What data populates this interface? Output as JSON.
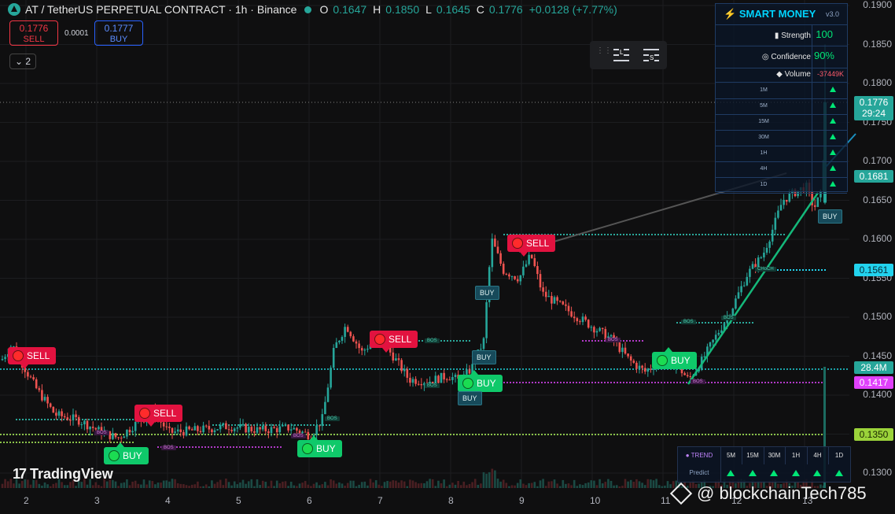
{
  "header": {
    "title": "AT / TetherUS PERPETUAL CONTRACT · 1h · Binance",
    "o_label": "O",
    "o_value": "0.1647",
    "h_label": "H",
    "h_value": "0.1850",
    "l_label": "L",
    "l_value": "0.1645",
    "c_label": "C",
    "c_value": "0.1776",
    "change": "+0.0128 (+7.77%)"
  },
  "trade": {
    "sell_price": "0.1776",
    "sell_label": "SELL",
    "spread": "0.0001",
    "buy_price": "0.1777",
    "buy_label": "BUY"
  },
  "indicators_toggle": "2",
  "toolbox": {
    "left_tag": "L",
    "right_tag": "S"
  },
  "price_axis": [
    "0.1900",
    "0.1850",
    "0.1800",
    "0.1750",
    "0.1700",
    "0.1650",
    "0.1600",
    "0.1550",
    "0.1500",
    "0.1450",
    "0.1400",
    "0.1350",
    "0.1300"
  ],
  "price_tags": {
    "last_price": "0.1776",
    "countdown": "29:24",
    "level_1681": "0.1681",
    "level_1561": "0.1561",
    "volume": "28.4M",
    "level_1417": "0.1417",
    "level_1350": "0.1350"
  },
  "time_axis": [
    "2",
    "3",
    "4",
    "5",
    "6",
    "7",
    "8",
    "9",
    "10",
    "11",
    "12",
    "13"
  ],
  "smart_money": {
    "title": "SMART MONEY",
    "version": "v3.0",
    "strength_label": "Strength",
    "strength": "100",
    "confidence_label": "Confidence",
    "confidence": "90%",
    "volume_label": "Volume",
    "volume": "-37449K",
    "timeframes": [
      "1M",
      "5M",
      "15M",
      "30M",
      "1H",
      "4H",
      "1D"
    ]
  },
  "trend_table": {
    "title": "TREND",
    "cols": [
      "5M",
      "15M",
      "30M",
      "1H",
      "4H",
      "1D"
    ],
    "row_label": "Predict"
  },
  "signals": [
    {
      "type": "sell",
      "label": "SELL"
    },
    {
      "type": "buy",
      "label": "BUY"
    },
    {
      "type": "sell",
      "label": "SELL"
    },
    {
      "type": "buy",
      "label": "BUY"
    },
    {
      "type": "sell",
      "label": "SELL"
    },
    {
      "type": "buy",
      "label": "BUY"
    },
    {
      "type": "sell",
      "label": "SELL"
    },
    {
      "type": "buy",
      "label": "BUY"
    }
  ],
  "small_buy_tags": [
    "BUY",
    "BUY",
    "BUY",
    "BUY"
  ],
  "bos_label": "BOS",
  "choch_label": "CHoCH",
  "branding": {
    "tradingview": "TradingView",
    "watermark": "@ blockchainTech785"
  },
  "colors": {
    "bull": "#26a69a",
    "bear": "#ef5350",
    "sell_signal": "#e2123f",
    "buy_signal": "#0fc96a",
    "accent": "#00d4ff"
  }
}
